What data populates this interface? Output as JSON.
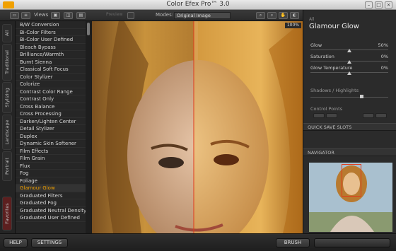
{
  "window": {
    "title": "Color Efex Pro™ 3.0"
  },
  "toolbar": {
    "views_label": "Views",
    "preview_label": "Preview",
    "modes_label": "Modes:",
    "modes_value": "Original Image"
  },
  "tabs": [
    "All",
    "Traditional",
    "Stylizing",
    "Landscape",
    "Portrait",
    "Favorites"
  ],
  "filters": [
    "B/W Conversion",
    "Bi-Color Filters",
    "Bi-Color User Defined",
    "Bleach Bypass",
    "Brilliance/Warmth",
    "Burnt Sienna",
    "Classical Soft Focus",
    "Color Stylizer",
    "Colorize",
    "Contrast Color Range",
    "Contrast Only",
    "Cross Balance",
    "Cross Processing",
    "Darken/Lighten Center",
    "Detail Stylizer",
    "Duplex",
    "Dynamic Skin Softener",
    "Film Effects",
    "Film Grain",
    "Flux",
    "Fog",
    "Foliage",
    "Glamour Glow",
    "Graduated Filters",
    "Graduated Fog",
    "Graduated Neutral Density",
    "Graduated User Defined"
  ],
  "selected_filter_index": 22,
  "zoom": "100%",
  "panel": {
    "header": "All",
    "filter_name": "Glamour Glow",
    "sliders": [
      {
        "label": "Glow",
        "value": "50%",
        "level": 0.5
      },
      {
        "label": "Saturation",
        "value": "0%",
        "level": 0.5
      },
      {
        "label": "Glow Temperature",
        "value": "0%",
        "level": 0.5
      }
    ],
    "shadows_highlights": "Shadows / Highlights",
    "control_points": "Control Points",
    "quick_save": "QUICK SAVE SLOTS",
    "navigator": "NAVIGATOR"
  },
  "bottom": {
    "help": "HELP",
    "settings": "SETTINGS",
    "brush": "BRUSH"
  }
}
